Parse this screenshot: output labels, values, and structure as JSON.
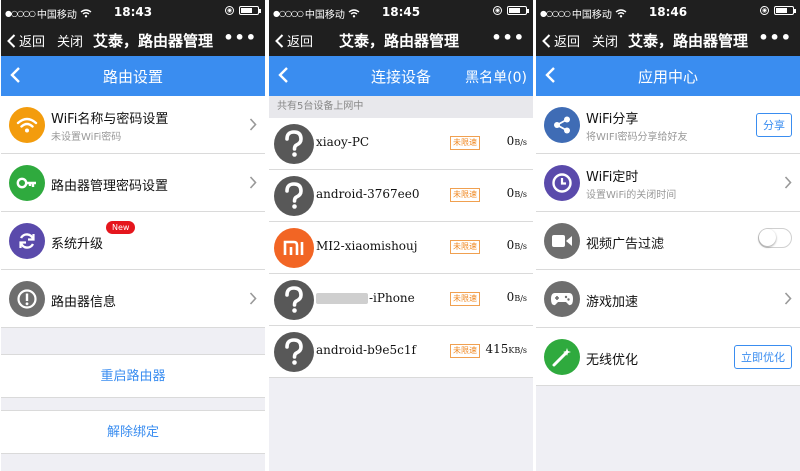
{
  "colors": {
    "accent": "#3a8df0",
    "titlebar": "#1f1f1f",
    "new_badge": "#e5161d",
    "limit_badge": "#f08a24"
  },
  "screens": [
    {
      "status": {
        "carrier": "中国移动",
        "time": "18:43"
      },
      "titlebar": {
        "back": "返回",
        "close": "关闭",
        "title": "艾泰，路由器管理",
        "more": "•••"
      },
      "nav": {
        "title": "路由设置"
      },
      "items": [
        {
          "icon": "wifi-icon",
          "title": "WiFi名称与密码设置",
          "subtitle": "未设置WiFi密码"
        },
        {
          "icon": "key-icon",
          "title": "路由器管理密码设置",
          "subtitle": ""
        },
        {
          "icon": "refresh-icon",
          "title": "系统升级",
          "badge": "New"
        },
        {
          "icon": "info-icon",
          "title": "路由器信息"
        }
      ],
      "actions": [
        "重启路由器",
        "解除绑定"
      ]
    },
    {
      "status": {
        "carrier": "中国移动",
        "time": "18:45"
      },
      "titlebar": {
        "back": "返回",
        "title": "艾泰，路由器管理",
        "more": "•••"
      },
      "nav": {
        "title": "连接设备",
        "right": "黑名单(0)"
      },
      "section_header": "共有5台设备上网中",
      "devices": [
        {
          "name": "xiaoy-PC",
          "badge": "未限速",
          "speed": "0",
          "unit": "B/s",
          "icon": "unknown-device-icon"
        },
        {
          "name": "android-3767ee0",
          "badge": "未限速",
          "speed": "0",
          "unit": "B/s",
          "icon": "unknown-device-icon"
        },
        {
          "name": "MI2-xiaomishouj",
          "badge": "未限速",
          "speed": "0",
          "unit": "B/s",
          "icon": "xiaomi-logo-icon"
        },
        {
          "name": "-iPhone",
          "badge": "未限速",
          "speed": "0",
          "unit": "B/s",
          "icon": "unknown-device-icon"
        },
        {
          "name": "android-b9e5c1f",
          "badge": "未限速",
          "speed": "415",
          "unit": "KB/s",
          "icon": "unknown-device-icon"
        }
      ]
    },
    {
      "status": {
        "carrier": "中国移动",
        "time": "18:46"
      },
      "titlebar": {
        "back": "返回",
        "close": "关闭",
        "title": "艾泰，路由器管理",
        "more": "•••"
      },
      "nav": {
        "title": "应用中心"
      },
      "apps": [
        {
          "icon": "share-icon",
          "title": "WiFi分享",
          "subtitle": "将WIFI密码分享给好友",
          "button": "分享"
        },
        {
          "icon": "clock-icon",
          "title": "WiFi定时",
          "subtitle": "设置WiFi的关闭时间"
        },
        {
          "icon": "video-camera-icon",
          "title": "视频广告过滤",
          "toggle": false
        },
        {
          "icon": "gamepad-icon",
          "title": "游戏加速"
        },
        {
          "icon": "magic-wand-icon",
          "title": "无线优化",
          "button": "立即优化"
        }
      ]
    }
  ]
}
